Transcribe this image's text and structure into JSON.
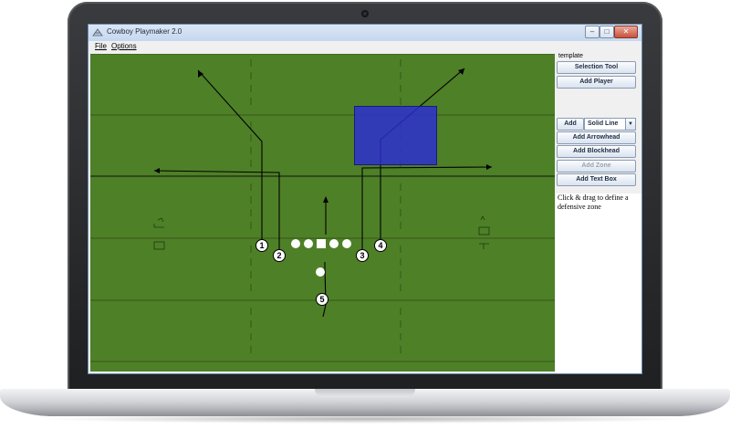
{
  "window": {
    "title": "Cowboy Playmaker 2.0",
    "controls": {
      "minimize": "–",
      "maximize": "□",
      "close": "✕"
    }
  },
  "menu": {
    "file": "File",
    "options": "Options"
  },
  "field": {
    "color": "#4e8027",
    "zone_color": "#2c2cd6",
    "players": [
      "1",
      "2",
      "3",
      "4",
      "5"
    ]
  },
  "panel": {
    "title": "template",
    "buttons": {
      "selection_tool": "Selection Tool",
      "add_player": "Add Player",
      "add": "Add",
      "line_style": "Solid Line",
      "add_arrowhead": "Add Arrowhead",
      "add_blockhead": "Add Blockhead",
      "add_zone": "Add Zone",
      "add_text_box": "Add Text Box"
    },
    "hint": "Click & drag to define a defensive zone"
  }
}
